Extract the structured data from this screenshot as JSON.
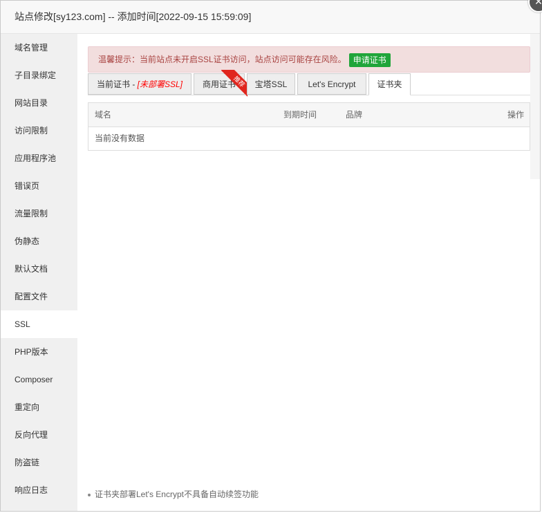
{
  "dialog": {
    "title": "站点修改[sy123.com] -- 添加时间[2022-09-15 15:59:09]",
    "close_glyph": "✕"
  },
  "sidebar": {
    "items": [
      {
        "label": "域名管理"
      },
      {
        "label": "子目录绑定"
      },
      {
        "label": "网站目录"
      },
      {
        "label": "访问限制"
      },
      {
        "label": "应用程序池"
      },
      {
        "label": "错误页"
      },
      {
        "label": "流量限制"
      },
      {
        "label": "伪静态"
      },
      {
        "label": "默认文档"
      },
      {
        "label": "配置文件"
      },
      {
        "label": "SSL"
      },
      {
        "label": "PHP版本"
      },
      {
        "label": "Composer"
      },
      {
        "label": "重定向"
      },
      {
        "label": "反向代理"
      },
      {
        "label": "防盗链"
      },
      {
        "label": "响应日志"
      }
    ],
    "active": "SSL"
  },
  "notice": {
    "text": "温馨提示：当前站点未开启SSL证书访问，站点访问可能存在风险。",
    "button": "申请证书"
  },
  "tabs": {
    "current_cert": "当前证书 - ",
    "current_cert_status": "[未部署SSL]",
    "commercial": "商用证书",
    "commercial_ribbon": "推荐",
    "baota": "宝塔SSL",
    "letsencrypt": "Let's Encrypt",
    "cert_folder": "证书夹",
    "active": "证书夹"
  },
  "table": {
    "headers": {
      "domain": "域名",
      "expiry": "到期时间",
      "brand": "品牌",
      "actions": "操作"
    },
    "empty_text": "当前没有数据"
  },
  "footnote": "证书夹部署Let's Encrypt不具备自动续签功能",
  "colors": {
    "accent_green": "#20a53a",
    "warning_red": "#ff0000",
    "notice_bg": "#f2dede",
    "notice_text": "#a94442"
  }
}
